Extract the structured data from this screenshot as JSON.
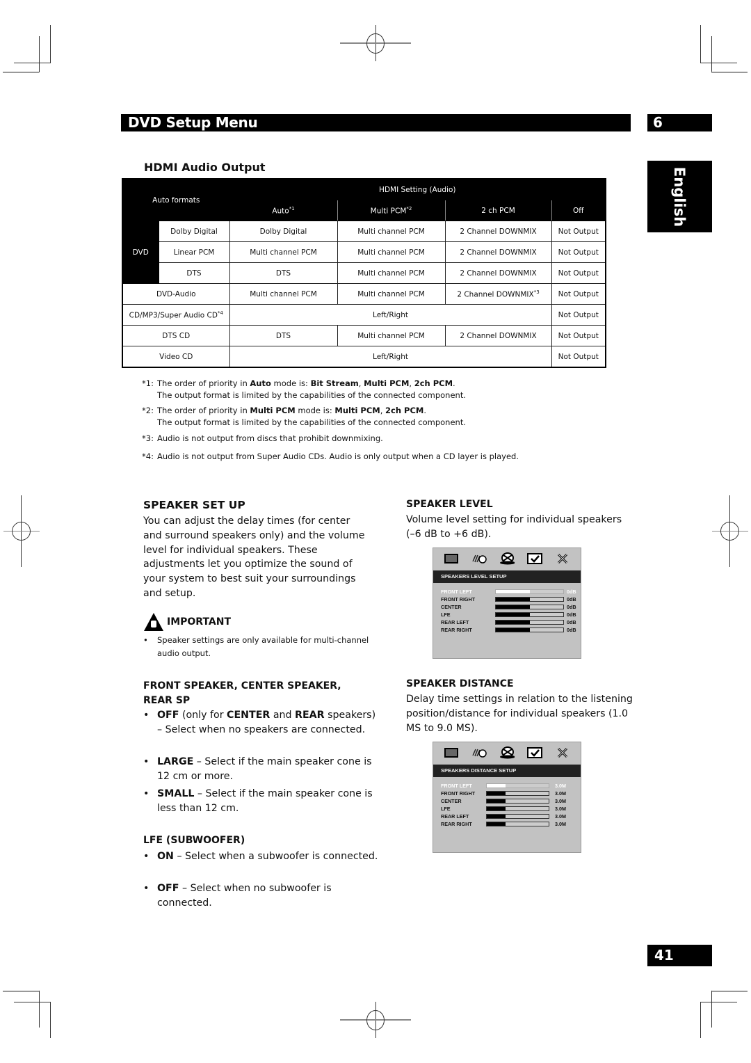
{
  "header": {
    "title": "DVD Setup Menu",
    "chapter": "6"
  },
  "language_tab": "English",
  "hdmi_section": {
    "title": "HDMI Audio Output",
    "table": {
      "corner_label": "Auto formats",
      "group_header": "HDMI Setting (Audio)",
      "columns": [
        {
          "label": "Auto",
          "note": "*1"
        },
        {
          "label": "Multi PCM",
          "note": "*2"
        },
        {
          "label": "2 ch PCM",
          "note": ""
        },
        {
          "label": "Off",
          "note": ""
        }
      ],
      "dvd_group_label": "DVD",
      "dvd_rows": [
        {
          "format": "Dolby Digital",
          "cells": [
            "Dolby Digital",
            "Multi channel PCM",
            "2 Channel DOWNMIX",
            "Not Output"
          ]
        },
        {
          "format": "Linear PCM",
          "cells": [
            "Multi channel PCM",
            "Multi channel PCM",
            "2 Channel DOWNMIX",
            "Not Output"
          ]
        },
        {
          "format": "DTS",
          "cells": [
            "DTS",
            "Multi channel PCM",
            "2 Channel DOWNMIX",
            "Not Output"
          ]
        }
      ],
      "other_rows": [
        {
          "format": "DVD-Audio",
          "format_note": "",
          "cells": [
            "Multi channel PCM",
            "Multi channel PCM",
            "2 Channel DOWNMIX",
            "Not Output"
          ],
          "cell_notes": [
            "",
            "",
            "*3",
            ""
          ]
        },
        {
          "format": "CD/MP3/Super Audio CD",
          "format_note": "*4",
          "merged": "Left/Right",
          "off": "Not Output"
        },
        {
          "format": "DTS CD",
          "format_note": "",
          "cells": [
            "DTS",
            "Multi channel PCM",
            "2 Channel DOWNMIX",
            "Not Output"
          ],
          "cell_notes": [
            "",
            "",
            "",
            ""
          ]
        },
        {
          "format": "Video CD",
          "format_note": "",
          "merged": "Left/Right",
          "off": "Not Output"
        }
      ]
    },
    "footnotes": [
      {
        "mark": "*1:",
        "parts": [
          "The order of priority in ",
          "Auto",
          " mode is: ",
          "Bit Stream",
          ", ",
          "Multi PCM",
          ", ",
          "2ch PCM",
          "."
        ],
        "continuation": "The output format is limited by the capabilities of the connected component."
      },
      {
        "mark": "*2:",
        "parts": [
          "The order of priority in ",
          "Multi PCM",
          " mode is: ",
          "Multi PCM",
          ", ",
          "2ch PCM",
          "."
        ],
        "continuation": "The output format is limited by the capabilities of the connected component."
      },
      {
        "mark": "*3:",
        "text": "Audio is not output from discs that prohibit downmixing."
      },
      {
        "mark": "*4:",
        "text": "Audio is not output from Super Audio CDs. Audio is only output when a CD layer is played."
      }
    ]
  },
  "speaker_setup": {
    "title": "SPEAKER SET UP",
    "intro": "You can adjust the delay times (for center and surround speakers only) and the volume level for individual speakers. These adjustments let you optimize the sound of your system to best suit your surroundings and setup.",
    "important_label": "IMPORTANT",
    "important_note": "Speaker settings are only available for multi-channel audio output.",
    "front_center_rear": {
      "title": "FRONT SPEAKER, CENTER SPEAKER, REAR SP",
      "items": [
        {
          "key": "OFF",
          "text_a": " (only for ",
          "key2": "CENTER",
          "text_b": " and ",
          "key3": "REAR",
          "text_c": " speakers) – Select when no speakers are connected."
        },
        {
          "key": "LARGE",
          "text": " – Select if the main speaker cone is 12 cm or more."
        },
        {
          "key": "SMALL",
          "text": " – Select if the main speaker cone is less than 12 cm."
        }
      ]
    },
    "lfe": {
      "title": "LFE (SUBWOOFER)",
      "items": [
        {
          "key": "ON",
          "text": " – Select when a subwoofer is connected."
        },
        {
          "key": "OFF",
          "text": " – Select when no subwoofer is connected."
        }
      ]
    }
  },
  "speaker_level": {
    "title": "SPEAKER LEVEL",
    "description": "Volume level setting for individual speakers (–6 dB to +6 dB).",
    "osd": {
      "title": "SPEAKERS LEVEL SETUP",
      "icons": [
        "display-icon",
        "audio-icon",
        "disc-icon",
        "check-icon",
        "close-icon"
      ],
      "rows": [
        {
          "label": "FRONT LEFT",
          "value": "0dB",
          "level": 0.5,
          "selected": true
        },
        {
          "label": "FRONT RIGHT",
          "value": "0dB",
          "level": 0.5,
          "selected": false
        },
        {
          "label": "CENTER",
          "value": "0dB",
          "level": 0.5,
          "selected": false
        },
        {
          "label": "LFE",
          "value": "0dB",
          "level": 0.5,
          "selected": false
        },
        {
          "label": "REAR LEFT",
          "value": "0dB",
          "level": 0.5,
          "selected": false
        },
        {
          "label": "REAR RIGHT",
          "value": "0dB",
          "level": 0.5,
          "selected": false
        }
      ]
    }
  },
  "speaker_distance": {
    "title": "SPEAKER DISTANCE",
    "description": "Delay time settings in relation to the listening position/distance for individual speakers (1.0 MS to 9.0 MS).",
    "osd": {
      "title": "SPEAKERS DISTANCE SETUP",
      "icons": [
        "display-icon",
        "audio-icon",
        "disc-icon",
        "check-icon",
        "close-icon"
      ],
      "rows": [
        {
          "label": "FRONT LEFT",
          "value": "3.0M",
          "level": 0.3,
          "selected": true
        },
        {
          "label": "FRONT RIGHT",
          "value": "3.0M",
          "level": 0.3,
          "selected": false
        },
        {
          "label": "CENTER",
          "value": "3.0M",
          "level": 0.3,
          "selected": false
        },
        {
          "label": "LFE",
          "value": "3.0M",
          "level": 0.3,
          "selected": false
        },
        {
          "label": "REAR LEFT",
          "value": "3.0M",
          "level": 0.3,
          "selected": false
        },
        {
          "label": "REAR RIGHT",
          "value": "3.0M",
          "level": 0.3,
          "selected": false
        }
      ]
    }
  },
  "page_number": "41"
}
